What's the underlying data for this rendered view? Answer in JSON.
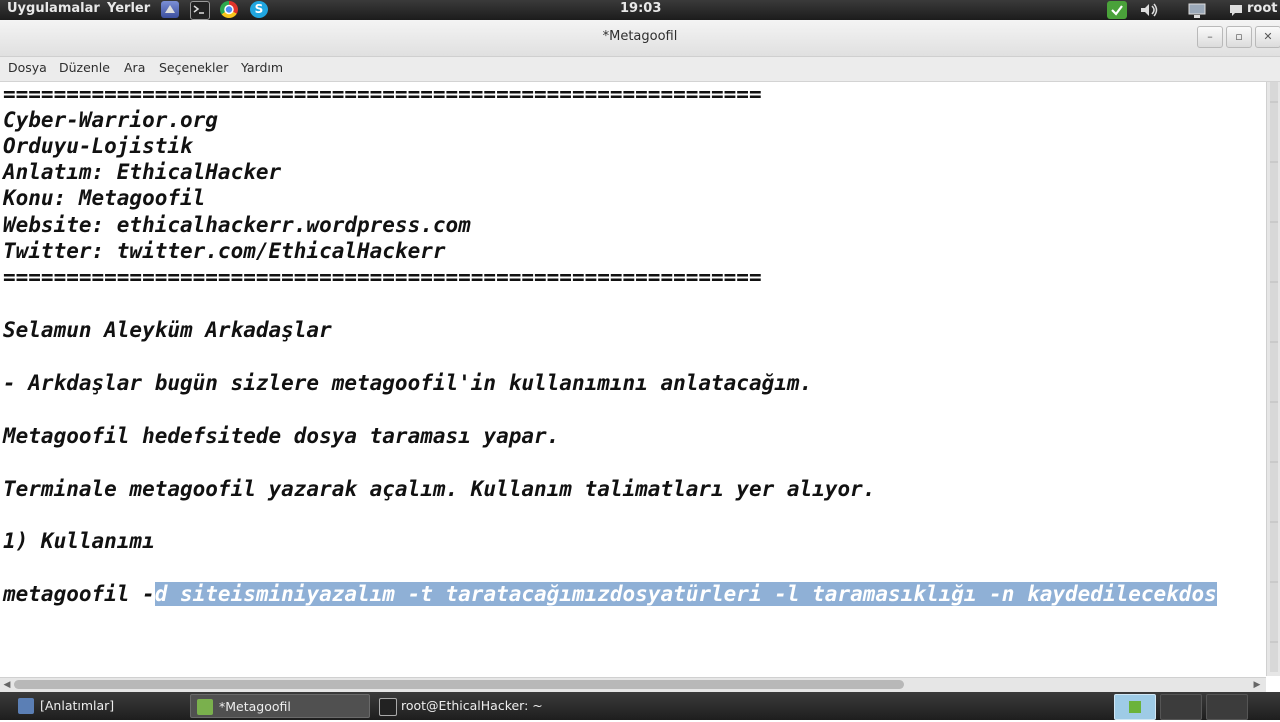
{
  "top_panel": {
    "apps_label": "Uygulamalar",
    "places_label": "Yerler",
    "clock": "19:03",
    "user": "root"
  },
  "window": {
    "title": "*Metagoofil",
    "min_glyph": "–",
    "max_glyph": "▫",
    "close_glyph": "✕"
  },
  "menu": {
    "file": "Dosya",
    "edit": "Düzenle",
    "search": "Ara",
    "options": "Seçenekler",
    "help": "Yardım"
  },
  "document": {
    "rule": "============================================================",
    "line_site": "Cyber-Warrior.org",
    "line_unit": "Orduyu-Lojistik",
    "line_author": "Anlatım: EthicalHacker",
    "line_topic": "Konu: Metagoofil",
    "line_website": "Website: ethicalhackerr.wordpress.com",
    "line_twitter": "Twitter: twitter.com/EthicalHackerr",
    "greeting": "Selamun Aleyküm Arkadaşlar",
    "intro": "- Arkdaşlar bugün sizlere metagoofil'in kullanımını anlatacağım.",
    "description": "Metagoofil hedefsitede dosya taraması yapar.",
    "instruction": "Terminale metagoofil yazarak açalım. Kullanım talimatları yer alıyor.",
    "section": "1) Kullanımı",
    "usage_prefix": "metagoofil -",
    "usage_selected": "d siteisminiyazalım -t taratacağımızdosyatürleri -l taramasıklığı -n kaydedilecekdos"
  },
  "taskbar": {
    "task1": "[Anlatımlar]",
    "task2": "*Metagoofil",
    "task3": "root@EthicalHacker: ~"
  },
  "colors": {
    "selection": "#8fb0d6",
    "panel": "#2a2a2a",
    "accent_green": "#6bb33b"
  }
}
